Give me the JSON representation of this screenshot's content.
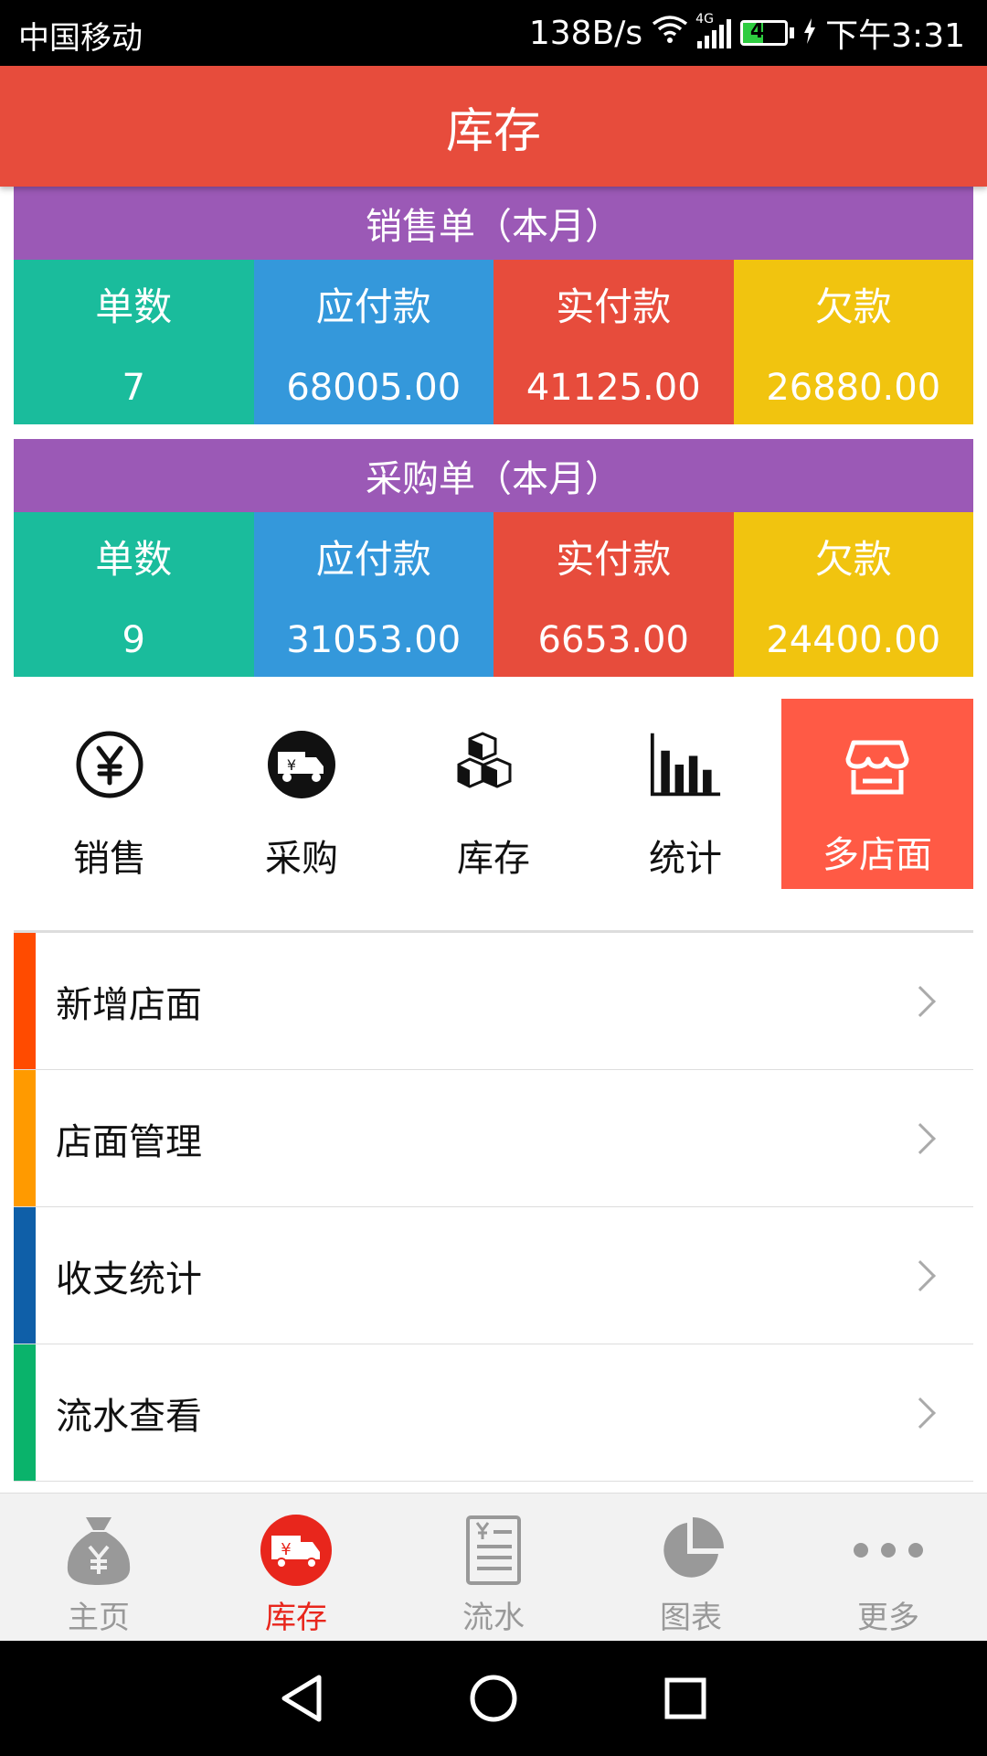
{
  "status_bar": {
    "carrier": "中国移动",
    "speed": "138B/s",
    "network": "4G",
    "battery": "47",
    "battery_level_pct": 47,
    "time": "下午3:31"
  },
  "header": {
    "title": "库存"
  },
  "sales_summary": {
    "title": "销售单（本月）",
    "columns": [
      {
        "label": "单数",
        "value": "7",
        "color": "#1abc9c"
      },
      {
        "label": "应付款",
        "value": "68005.00",
        "color": "#3498db"
      },
      {
        "label": "实付款",
        "value": "41125.00",
        "color": "#e74c3c"
      },
      {
        "label": "欠款",
        "value": "26880.00",
        "color": "#f1c40f"
      }
    ]
  },
  "purchase_summary": {
    "title": "采购单（本月）",
    "columns": [
      {
        "label": "单数",
        "value": "9",
        "color": "#1abc9c"
      },
      {
        "label": "应付款",
        "value": "31053.00",
        "color": "#3498db"
      },
      {
        "label": "实付款",
        "value": "6653.00",
        "color": "#e74c3c"
      },
      {
        "label": "欠款",
        "value": "24400.00",
        "color": "#f1c40f"
      }
    ]
  },
  "quick_actions": [
    {
      "label": "销售",
      "icon": "yen-circle-icon"
    },
    {
      "label": "采购",
      "icon": "delivery-truck-icon"
    },
    {
      "label": "库存",
      "icon": "boxes-icon"
    },
    {
      "label": "统计",
      "icon": "bar-chart-icon"
    },
    {
      "label": "多店面",
      "icon": "store-icon",
      "active": true
    }
  ],
  "menu": [
    {
      "label": "新增店面",
      "color": "#ff4b00"
    },
    {
      "label": "店面管理",
      "color": "#ff9a00"
    },
    {
      "label": "收支统计",
      "color": "#0f5fa8"
    },
    {
      "label": "流水查看",
      "color": "#0ab36b"
    }
  ],
  "tabs": [
    {
      "label": "主页",
      "icon": "money-bag-icon"
    },
    {
      "label": "库存",
      "icon": "delivery-truck-icon",
      "active": true
    },
    {
      "label": "流水",
      "icon": "receipt-icon"
    },
    {
      "label": "图表",
      "icon": "pie-chart-icon"
    },
    {
      "label": "更多",
      "icon": "more-dots-icon"
    }
  ],
  "colors": {
    "header": "#e74c3c",
    "summary_title": "#9b59b6",
    "active_action": "#ff5a45",
    "active_tab": "#e8261c"
  }
}
